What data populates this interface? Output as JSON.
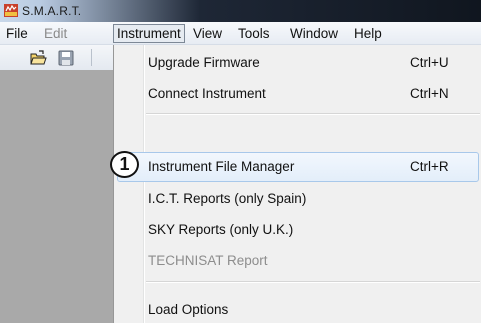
{
  "window": {
    "title": "S.M.A.R.T.",
    "icon": "app-logo-icon"
  },
  "menubar": {
    "items": [
      {
        "label": "File"
      },
      {
        "label": "Edit",
        "disabled": true
      },
      {
        "label": "Instrument",
        "open": true
      },
      {
        "label": "View"
      },
      {
        "label": "Tools"
      },
      {
        "label": "Window"
      },
      {
        "label": "Help"
      }
    ]
  },
  "toolbar": {
    "icons": [
      "open-folder-icon",
      "save-disk-icon"
    ]
  },
  "dropdown": {
    "items": [
      {
        "label": "Upgrade Firmware",
        "shortcut": "Ctrl+U"
      },
      {
        "label": "Connect Instrument",
        "shortcut": "Ctrl+N"
      },
      {
        "label": "Instrument File Manager",
        "shortcut": "Ctrl+R",
        "highlighted": true
      },
      {
        "label": "I.C.T. Reports (only Spain)",
        "shortcut": ""
      },
      {
        "label": "SKY Reports (only U.K.)",
        "shortcut": ""
      },
      {
        "label": "TECHNISAT Report",
        "shortcut": "",
        "disabled": true
      },
      {
        "label": "Load Options",
        "shortcut": ""
      }
    ]
  },
  "callout": {
    "label": "1"
  },
  "colors": {
    "highlight_border": "#a8c8ea",
    "panel_gray": "#a9a9a9",
    "menu_bg": "#f0f0f0"
  }
}
